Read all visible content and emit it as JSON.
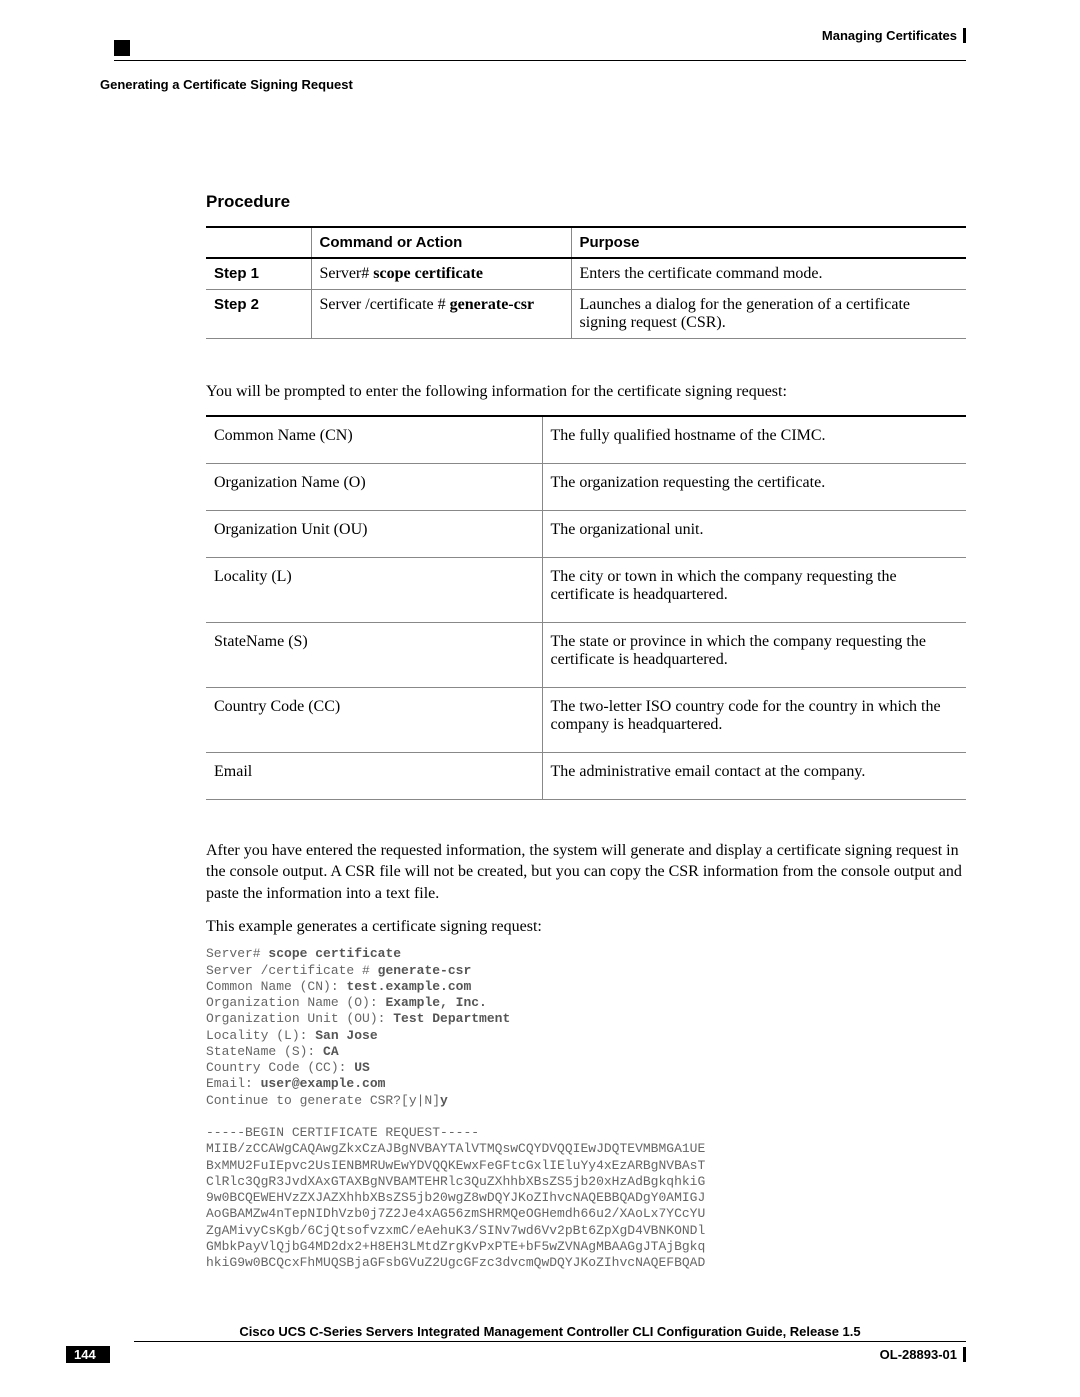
{
  "header": {
    "right": "Managing Certificates",
    "left": "Generating a Certificate Signing Request"
  },
  "procedure_heading": "Procedure",
  "proc_table": {
    "headers": [
      "",
      "Command or Action",
      "Purpose"
    ],
    "rows": [
      {
        "step": "Step 1",
        "cmd_prefix": "Server# ",
        "cmd_bold": "scope certificate",
        "purpose": "Enters the certificate command mode."
      },
      {
        "step": "Step 2",
        "cmd_prefix": "Server /certificate # ",
        "cmd_bold": "generate-csr",
        "purpose": "Launches a dialog for the generation of a certificate signing request (CSR)."
      }
    ]
  },
  "prompt_text": "You will be prompted to enter the following information for the certificate signing request:",
  "fields": [
    {
      "name": "Common Name (CN)",
      "desc": "The fully qualified hostname of the CIMC."
    },
    {
      "name": "Organization Name (O)",
      "desc": "The organization requesting the certificate."
    },
    {
      "name": "Organization Unit (OU)",
      "desc": "The organizational unit."
    },
    {
      "name": "Locality (L)",
      "desc": "The city or town in which the company requesting the certificate is headquartered."
    },
    {
      "name": "StateName (S)",
      "desc": "The state or province in which the company requesting the certificate is headquartered."
    },
    {
      "name": "Country Code (CC)",
      "desc": "The two-letter ISO country code for the country in which the company is headquartered."
    },
    {
      "name": "Email",
      "desc": "The administrative email contact at the company."
    }
  ],
  "after_text": "After you have entered the requested information, the system will generate and display a certificate signing request in the console output. A CSR file will not be created, but you can copy the CSR information from the console output and paste the information into a text file.",
  "example_text": "This example generates a certificate signing request:",
  "code": {
    "l1a": "Server# ",
    "l1b": "scope certificate",
    "l2a": "Server /certificate # ",
    "l2b": "generate-csr",
    "l3a": "Common Name (CN): ",
    "l3b": "test.example.com",
    "l4a": "Organization Name (O): ",
    "l4b": "Example, Inc.",
    "l5a": "Organization Unit (OU): ",
    "l5b": "Test Department",
    "l6a": "Locality (L): ",
    "l6b": "San Jose",
    "l7a": "StateName (S): ",
    "l7b": "CA",
    "l8a": "Country Code (CC): ",
    "l8b": "US",
    "l9a": "Email: ",
    "l9b": "user@example.com",
    "l10a": "Continue to generate CSR?[y|N]",
    "l10b": "y",
    "blank": "",
    "c1": "-----BEGIN CERTIFICATE REQUEST-----",
    "c2": "MIIB/zCCAWgCAQAwgZkxCzAJBgNVBAYTAlVTMQswCQYDVQQIEwJDQTEVMBMGA1UE",
    "c3": "BxMMU2FuIEpvc2UsIENBMRUwEwYDVQQKEwxFeGFtcGxlIEluYy4xEzARBgNVBAsT",
    "c4": "ClRlc3QgR3JvdXAxGTAXBgNVBAMTEHRlc3QuZXhhbXBsZS5jb20xHzAdBgkqhkiG",
    "c5": "9w0BCQEWEHVzZXJAZXhhbXBsZS5jb20wgZ8wDQYJKoZIhvcNAQEBBQADgY0AMIGJ",
    "c6": "AoGBAMZw4nTepNIDhVzb0j7Z2Je4xAG56zmSHRMQeOGHemdh66u2/XAoLx7YCcYU",
    "c7": "ZgAMivyCsKgb/6CjQtsofvzxmC/eAehuK3/SINv7wd6Vv2pBt6ZpXgD4VBNKONDl",
    "c8": "GMbkPayVlQjbG4MD2dx2+H8EH3LMtdZrgKvPxPTE+bF5wZVNAgMBAAGgJTAjBgkq",
    "c9": "hkiG9w0BCQcxFhMUQSBjaGFsbGVuZ2UgcGFzc3dvcmQwDQYJKoZIhvcNAQEFBQAD"
  },
  "footer": {
    "title": "Cisco UCS C-Series Servers Integrated Management Controller CLI Configuration Guide, Release 1.5",
    "page": "144",
    "docid": "OL-28893-01"
  }
}
